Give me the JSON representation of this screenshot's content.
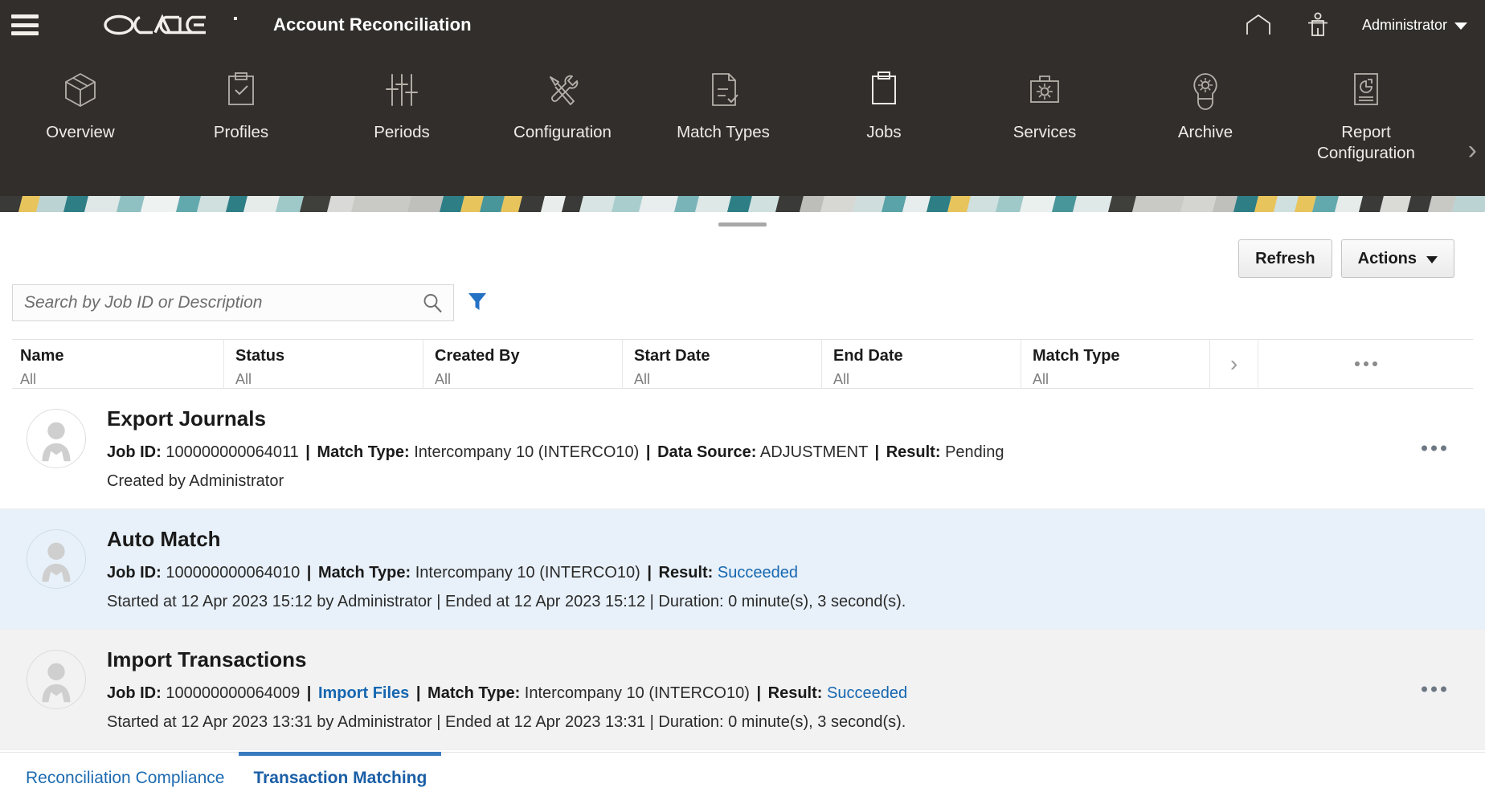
{
  "header": {
    "menu_icon": "hamburger-menu-icon",
    "brand": "ORACLE",
    "app_title": "Account Reconciliation",
    "home_icon": "home-icon",
    "accessibility_icon": "accessibility-person-icon",
    "user_label": "Administrator",
    "user_caret_icon": "chevron-down-icon"
  },
  "nav": {
    "next_icon": "chevron-right-icon",
    "items": [
      {
        "label": "Overview",
        "icon": "cube-icon"
      },
      {
        "label": "Profiles",
        "icon": "clipboard-check-icon"
      },
      {
        "label": "Periods",
        "icon": "sliders-icon"
      },
      {
        "label": "Configuration",
        "icon": "hammer-wrench-icon"
      },
      {
        "label": "Match Types",
        "icon": "document-check-icon"
      },
      {
        "label": "Jobs",
        "icon": "clipboard-icon"
      },
      {
        "label": "Services",
        "icon": "toolbox-gear-icon"
      },
      {
        "label": "Archive",
        "icon": "lightbulb-gear-icon"
      },
      {
        "label": "Report Configuration",
        "icon": "report-piechart-icon"
      }
    ]
  },
  "toolbar": {
    "drag_handle": "panel-drag-handle",
    "refresh_label": "Refresh",
    "actions_label": "Actions",
    "actions_caret_icon": "caret-down-icon"
  },
  "search": {
    "value": "",
    "placeholder": "Search by Job ID or Description",
    "search_icon": "search-magnifier-icon",
    "filter_icon": "funnel-filter-icon"
  },
  "table": {
    "columns": [
      {
        "title": "Name",
        "filter": "All"
      },
      {
        "title": "Status",
        "filter": "All"
      },
      {
        "title": "Created By",
        "filter": "All"
      },
      {
        "title": "Start Date",
        "filter": "All"
      },
      {
        "title": "End Date",
        "filter": "All"
      },
      {
        "title": "Match Type",
        "filter": "All"
      }
    ],
    "expand_icon": "chevron-right-icon",
    "more_icon": "ellipsis-horizontal-icon"
  },
  "jobs": [
    {
      "name": "Export Journals",
      "avatar_icon": "user-avatar-icon",
      "row_menu_icon": "ellipsis-horizontal-icon",
      "meta": {
        "job_id_label": "Job ID:",
        "job_id": "100000000064011",
        "match_type_label": "Match Type:",
        "match_type": "Intercompany 10 (INTERCO10)",
        "data_source_label": "Data Source:",
        "data_source": "ADJUSTMENT",
        "result_label": "Result:",
        "result": "Pending"
      },
      "sub": "Created by Administrator",
      "highlight": "none"
    },
    {
      "name": "Auto Match",
      "avatar_icon": "user-avatar-icon",
      "row_menu_icon": "ellipsis-horizontal-icon",
      "meta": {
        "job_id_label": "Job ID:",
        "job_id": "100000000064010",
        "match_type_label": "Match Type:",
        "match_type": "Intercompany 10 (INTERCO10)",
        "result_label": "Result:",
        "result": "Succeeded"
      },
      "sub": "Started at 12 Apr 2023 15:12 by Administrator  | Ended at 12 Apr 2023 15:12 | Duration: 0 minute(s), 3 second(s).",
      "highlight": "blue"
    },
    {
      "name": "Import Transactions",
      "avatar_icon": "user-avatar-icon",
      "row_menu_icon": "ellipsis-horizontal-icon",
      "meta": {
        "job_id_label": "Job ID:",
        "job_id": "100000000064009",
        "import_files_link": "Import Files",
        "match_type_label": "Match Type:",
        "match_type": "Intercompany 10 (INTERCO10)",
        "result_label": "Result:",
        "result": "Succeeded"
      },
      "sub": "Started at 12 Apr 2023 13:31 by Administrator  | Ended at 12 Apr 2023 13:31 | Duration: 0 minute(s), 3 second(s).",
      "highlight": "grey"
    }
  ],
  "bottom_tabs": [
    {
      "label": "Reconciliation Compliance",
      "active": false
    },
    {
      "label": "Transaction Matching",
      "active": true
    }
  ],
  "colors": {
    "header_bg": "#312e2b",
    "link_blue": "#1667b1",
    "tab_active_blue": "#3a7bbf",
    "row_highlight_blue": "#e8f1f9",
    "row_highlight_grey": "#f2f2f2",
    "filter_icon_blue": "#2572c4"
  }
}
